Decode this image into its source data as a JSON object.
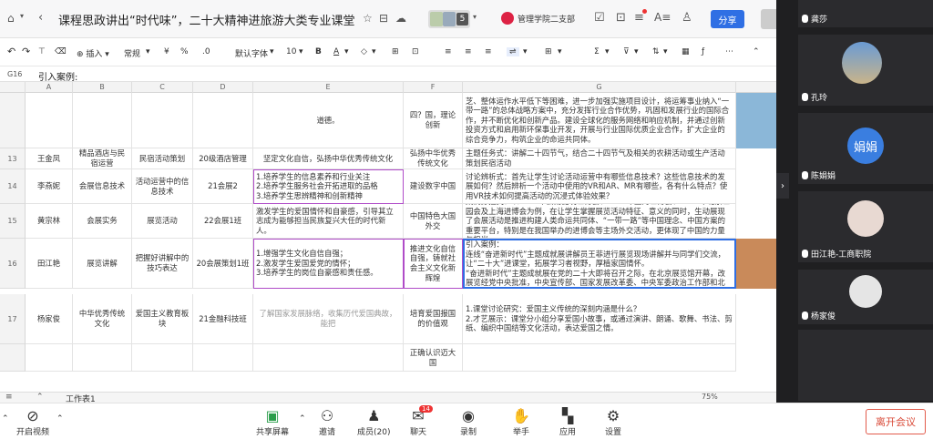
{
  "titlebar": {
    "doc_title": "课程思政讲出“时代味”，二十大精神进旅游大类专业课堂",
    "badge_count": "5",
    "org": "管理学院二支部",
    "share_label": "分享"
  },
  "toolbar": {
    "insert": "插入",
    "format": "常规",
    "decimal": ".0",
    "font": "默认字体",
    "size": "10",
    "bold": "B",
    "font_color": "A",
    "sum": "Σ"
  },
  "formula_bar": {
    "cell_ref": "G16",
    "content": "引入案例:"
  },
  "columns": [
    "A",
    "B",
    "C",
    "D",
    "E",
    "F",
    "G"
  ],
  "rows": [
    {
      "num": "",
      "A": "",
      "B": "",
      "C": "",
      "D": "",
      "E": "道德。",
      "F": "四？国，理论创新",
      "G": "芝、整体运作水平低下等困难，进一步加强实施项目设计，将运筹事业纳入“一带一路”的总体战略方案中，充分发挥行业合作优势，巩固和发展行业的国际合作，并不断优化和创新产品。建设全球化的服务网络和响应机制，并通过创新投资方式和启用新环保事业开发，开展与行业国际优质企业合作，扩大企业的综合竞争力，构筑企业的命运共同体。"
    },
    {
      "num": "13",
      "A": "王金凤",
      "B": "精品酒店与民宿运营",
      "C": "民宿活动策划",
      "D": "20级酒店管理",
      "E": "坚定文化自信，弘扬中华优秀传统文化",
      "F": "弘扬中华优秀传统文化",
      "G": "主题任务式：讲解二十四节气，结合二十四节气及相关的农耕活动或生产活动策划民宿活动"
    },
    {
      "num": "14",
      "A": "李燕妮",
      "B": "会展信息技术",
      "C": "活动运营中的信息技术",
      "D": "21会展2",
      "E": "1.培养学生的信息素养和行业关注\n2.培养学生服务社会开拓进取的品格\n3.培养学生思辨精神和创新精神",
      "F": "建设数字中国",
      "G": "讨论辨析式：首先让学生讨论活动运营中有哪些信息技术？这些信息技术的发展如何？然后辨析一个活动中使用的VR和AR、MR有哪些，各有什么特点？使用VR技术如何提高活动的沉浸式体验效果？"
    },
    {
      "num": "15",
      "A": "黄宗林",
      "B": "会展实务",
      "C": "展览活动",
      "D": "22会展1班",
      "E": "激发学生的爱国情怀和自豪感，引导其立志成为能够担当民族复兴大任的时代新人。",
      "F": "中国特色大国外交",
      "G": "案例穿插式：以1999年云南昆明世博会、2010年上海世博会、2019年北京世园会及上海进博会为例，在让学生掌握展览活动特征、意义的同时，生动展现了会展活动是推进构建人类命运共同体、“一带一路”等中国理念、中国方案的重要平台，特别是在我国举办的进博会等主场外交活动，更体现了中国的力量与担当。"
    },
    {
      "num": "16",
      "A": "田江艳",
      "B": "展览讲解",
      "C": "把握好讲解中的技巧表达",
      "D": "20会展策划1班",
      "E": "1.增强学生文化自信自强；\n2.激发学生爱国爱党的情怀；\n3.培养学生的岗位自豪感和责任感。",
      "F": "推进文化自信自强，铸就社会主义文化新辉煌",
      "G": "引入案例：\n    连线“奋进新时代”主题成就展讲解员王菲进行展览现场讲解并与同学们交流，让“二十大”进课堂，拓展学习者视野，厚植家国情怀。\n    “奋进新时代”主题成就展在党的二十大即将召开之际，在北京展览馆开幕，改展览经党中央批准，中央宣传部、国家发展改革委、中央军委政治工作部和北京市委市政府联合主办，展览聚焦新时代10年党和国家事业的伟大成就、伟大变革，既展现事业发展的新局面新貌，又揭示变革背后的思想力量和动能；既展现新时代中国共产党人的政治引领、思想指引，又反映广大人民群众团结一心、干事创业的良好风貌。"
    },
    {
      "num": "17",
      "A": "杨家俊",
      "B": "中华优秀传统文化",
      "C": "爱国主义教育板块",
      "D": "21金融科技班",
      "E": "了解国家发展脉络，收集历代爱国典故，能把",
      "F": "培育爱国报国的价值观",
      "G": "1.课堂讨论研究：爱国主义传统的深刻内涵是什么？\n2.才艺展示：课堂分小组分享爱国小故事，或通过演讲、朗诵、歌舞、书法、剪纸、编织中国结等文化活动，表达爱国之情。"
    },
    {
      "num": "",
      "A": "",
      "B": "",
      "C": "",
      "D": "",
      "E": "",
      "F": "正确认识迈大国",
      "G": ""
    }
  ],
  "sheet": {
    "tab_name": "工作表1",
    "zoom": "75%"
  },
  "bottom": {
    "video": "开启视频",
    "share_screen": "共享屏幕",
    "invite": "邀请",
    "members": "成员(20)",
    "chat": "聊天",
    "chat_badge": "14",
    "record": "录制",
    "raise_hand": "举手",
    "apps": "应用",
    "settings": "设置",
    "leave": "离开会议"
  },
  "participants": [
    {
      "name": "龚莎"
    },
    {
      "name": "孔玲"
    },
    {
      "name": "陈娟娟",
      "initials": "娟娟"
    },
    {
      "name": "田江艳-工商职院"
    },
    {
      "name": "杨家俊"
    }
  ],
  "colors": {
    "accent": "#2f6fe4",
    "highlight": "#b04cc8",
    "leave": "#d94a38",
    "panel": "#1f1f21"
  }
}
